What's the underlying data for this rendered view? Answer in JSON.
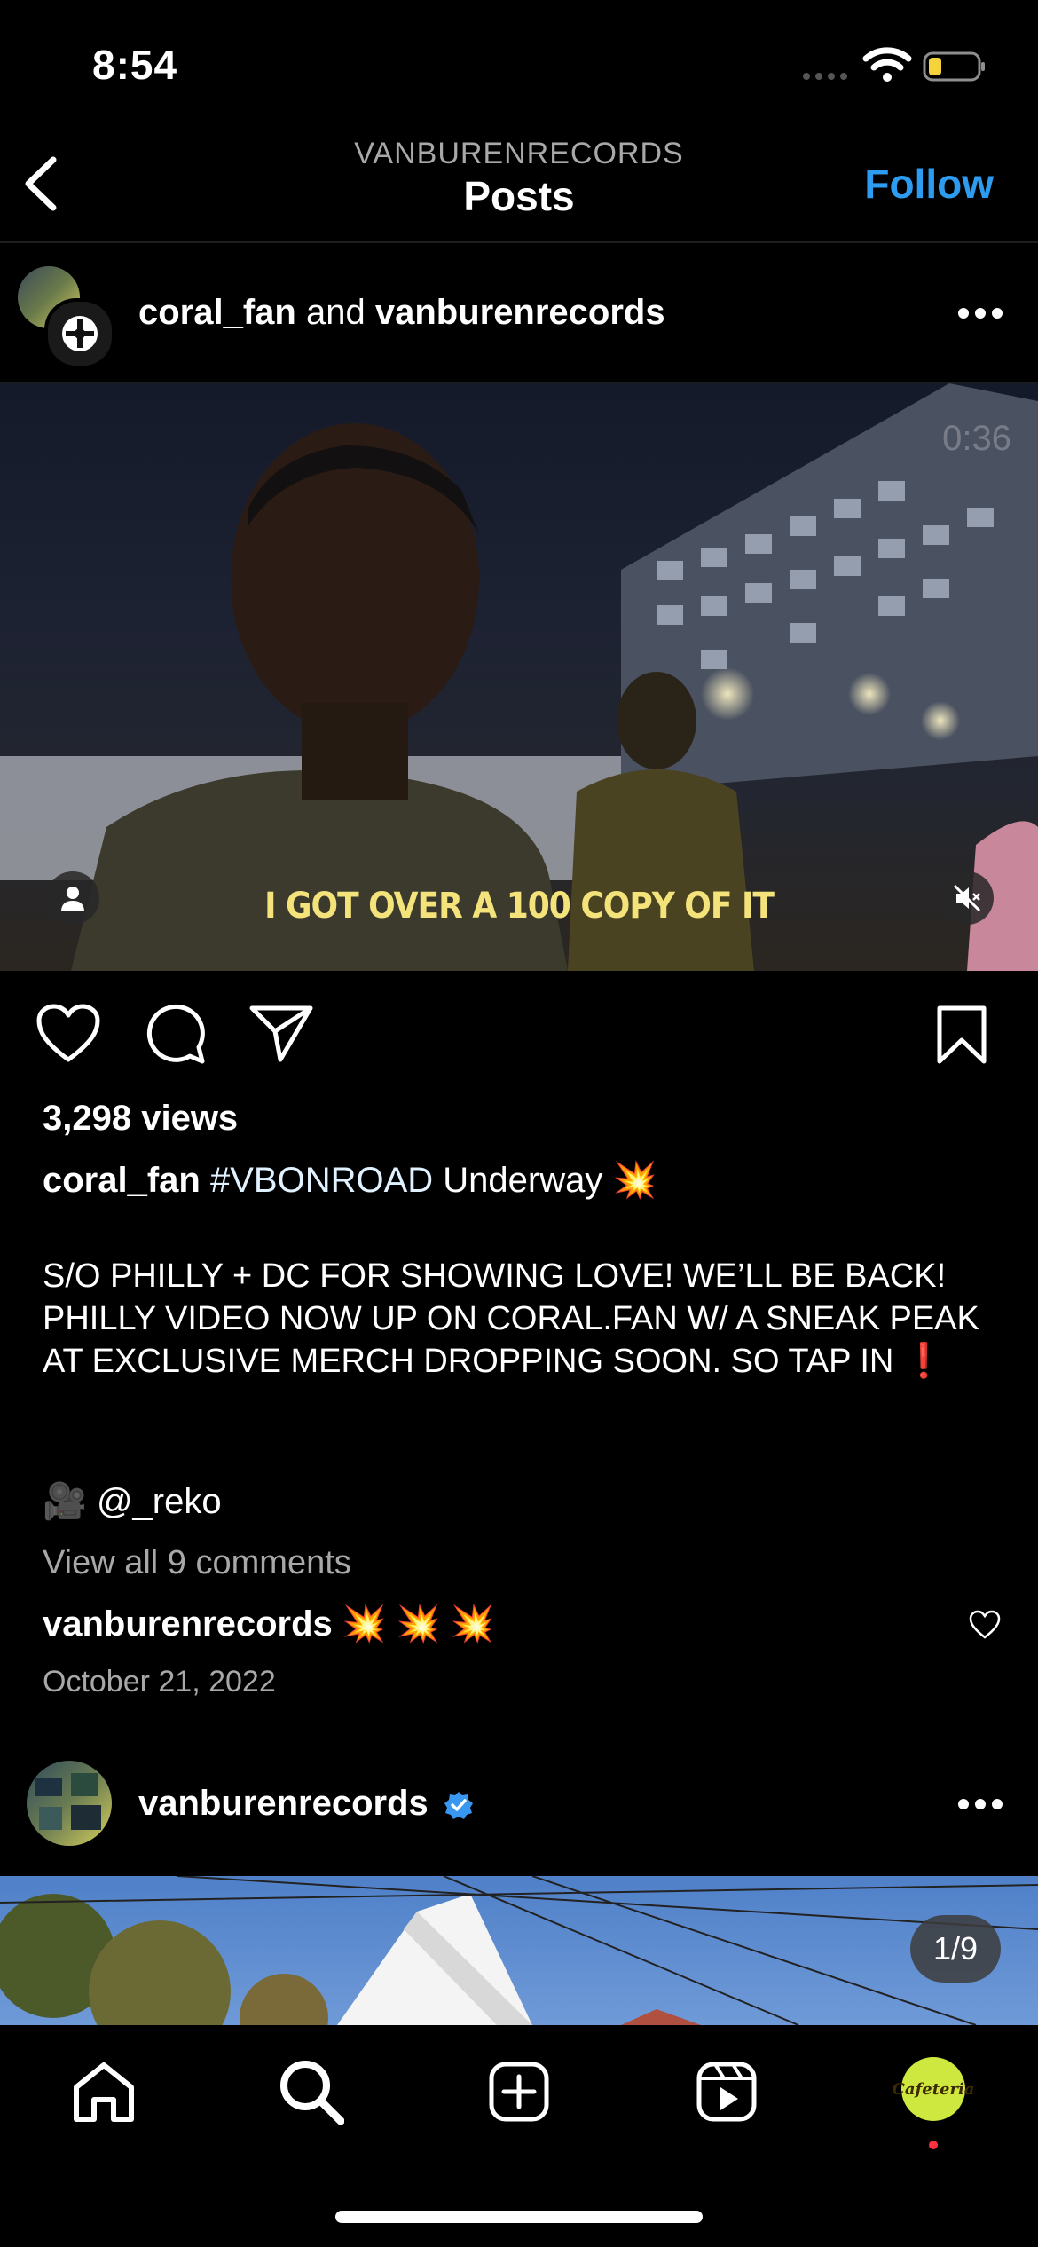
{
  "status_bar": {
    "time": "8:54"
  },
  "header": {
    "subtitle": "VANBURENRECORDS",
    "title": "Posts",
    "follow_label": "Follow"
  },
  "post1": {
    "user_primary": "coral_fan",
    "joiner": " and ",
    "user_secondary": "vanburenrecords",
    "video_time": "0:36",
    "video_subtitle": "I GOT OVER A 100 COPY OF IT",
    "views": "3,298 views",
    "caption_user": "coral_fan",
    "caption_hashtag": "#VBONROAD",
    "caption_rest": " Underway 💥",
    "body": "S/O PHILLY + DC FOR SHOWING LOVE! WE’LL BE BACK! PHILLY VIDEO NOW UP ON CORAL.FAN W/ A SNEAK PEAK AT EXCLUSIVE MERCH DROPPING SOON. SO TAP IN ❗",
    "credit_emoji": "🎥",
    "credit_handle": "@_reko",
    "view_all_comments": "View all 9 comments",
    "comment_user": "vanburenrecords",
    "comment_text": "💥 💥 💥",
    "date": "October 21, 2022"
  },
  "post2": {
    "username": "vanburenrecords",
    "counter": "1/9"
  },
  "tabbar": {
    "profile_label": "Cafeteria"
  },
  "colors": {
    "accent": "#2d9cf0",
    "verified": "#3897f0",
    "notification": "#ff3040"
  }
}
